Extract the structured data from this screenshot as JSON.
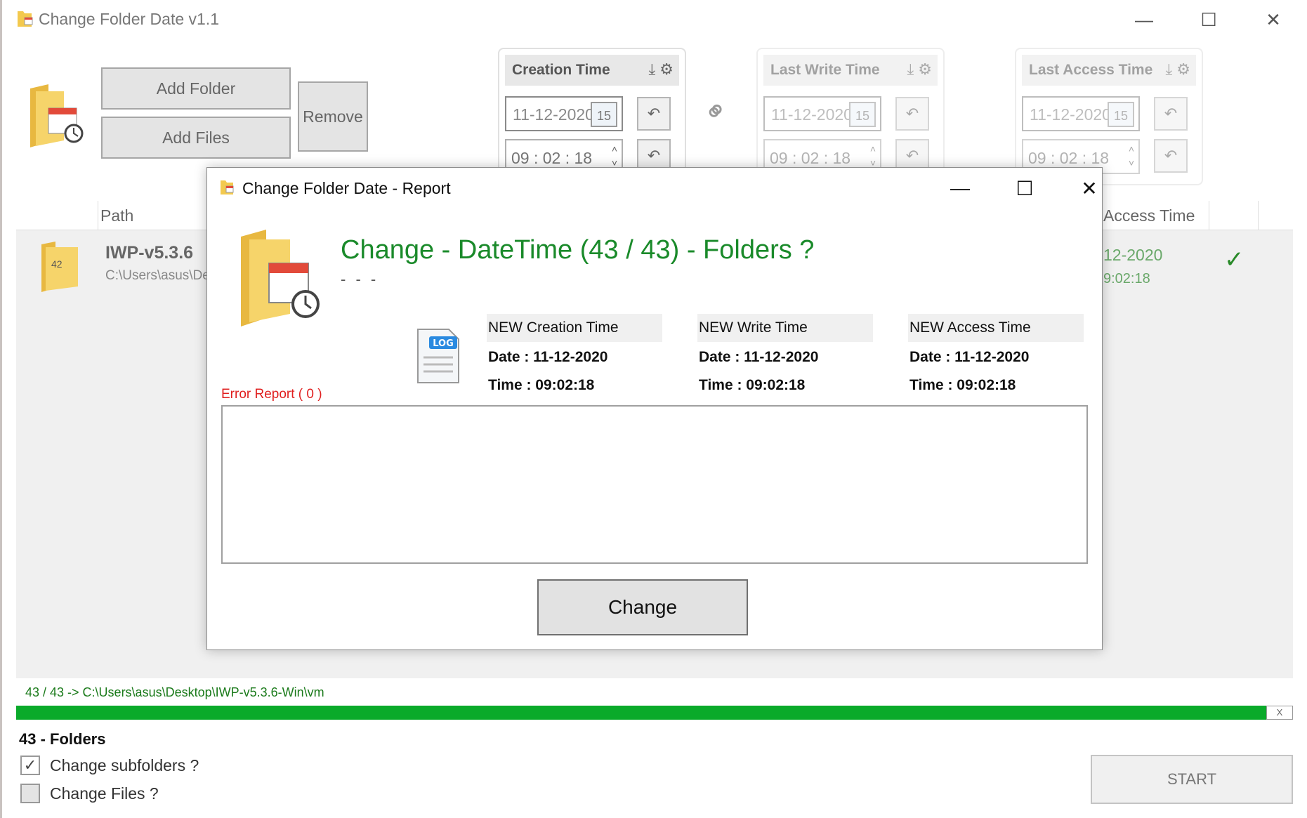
{
  "app": {
    "title": "Change Folder Date v1.1",
    "window_controls": {
      "minimize": "—",
      "maximize": "☐",
      "close": "✕"
    }
  },
  "toolbar": {
    "add_folder_label": "Add Folder",
    "add_files_label": "Add Files",
    "remove_label": "Remove"
  },
  "time_panels": [
    {
      "label": "Creation Time",
      "date": "11-12-2020",
      "time": "09 : 02 : 18",
      "calendar_day": "15",
      "enabled": true
    },
    {
      "label": "Last Write Time",
      "date": "11-12-2020",
      "time": "09 : 02 : 18",
      "calendar_day": "15",
      "enabled": false
    },
    {
      "label": "Last Access Time",
      "date": "11-12-2020",
      "time": "09 : 02 : 18",
      "calendar_day": "15",
      "enabled": false
    }
  ],
  "list": {
    "columns": {
      "path": "Path",
      "access_time": "Access Time"
    },
    "rows": [
      {
        "count": "42",
        "name": "IWP-v5.3.6",
        "path": "C:\\Users\\asus\\De",
        "access_date": "12-2020",
        "access_time": "9:02:18",
        "status_icon": "checkmark-icon"
      }
    ]
  },
  "status": {
    "progress_text": "43 / 43 -> C:\\Users\\asus\\Desktop\\IWP-v5.3.6-Win\\vm",
    "progress_fraction": 0.98,
    "progress_close": "X",
    "folders_count": "43 - Folders"
  },
  "options": {
    "change_subfolders_label": "Change subfolders ?",
    "change_subfolders_checked": true,
    "change_files_label": "Change Files ?",
    "change_files_checked": false
  },
  "start_label": "START",
  "dialog": {
    "title": "Change Folder Date - Report",
    "heading": "Change - DateTime (43 / 43) - Folders ?",
    "subheading": "- - -",
    "log_label": "LOG",
    "columns": [
      {
        "header": "NEW Creation Time",
        "date": "Date : 11-12-2020",
        "time": "Time : 09:02:18"
      },
      {
        "header": "NEW Write Time",
        "date": "Date : 11-12-2020",
        "time": "Time : 09:02:18"
      },
      {
        "header": "NEW Access Time",
        "date": "Date : 11-12-2020",
        "time": "Time : 09:02:18"
      }
    ],
    "error_label": "Error Report ( 0 )",
    "change_label": "Change"
  },
  "colors": {
    "accent_green": "#1a8a2a",
    "progress_green": "#0aaa2a",
    "error_red": "#e02020",
    "folder_yellow": "#f5d15a"
  }
}
